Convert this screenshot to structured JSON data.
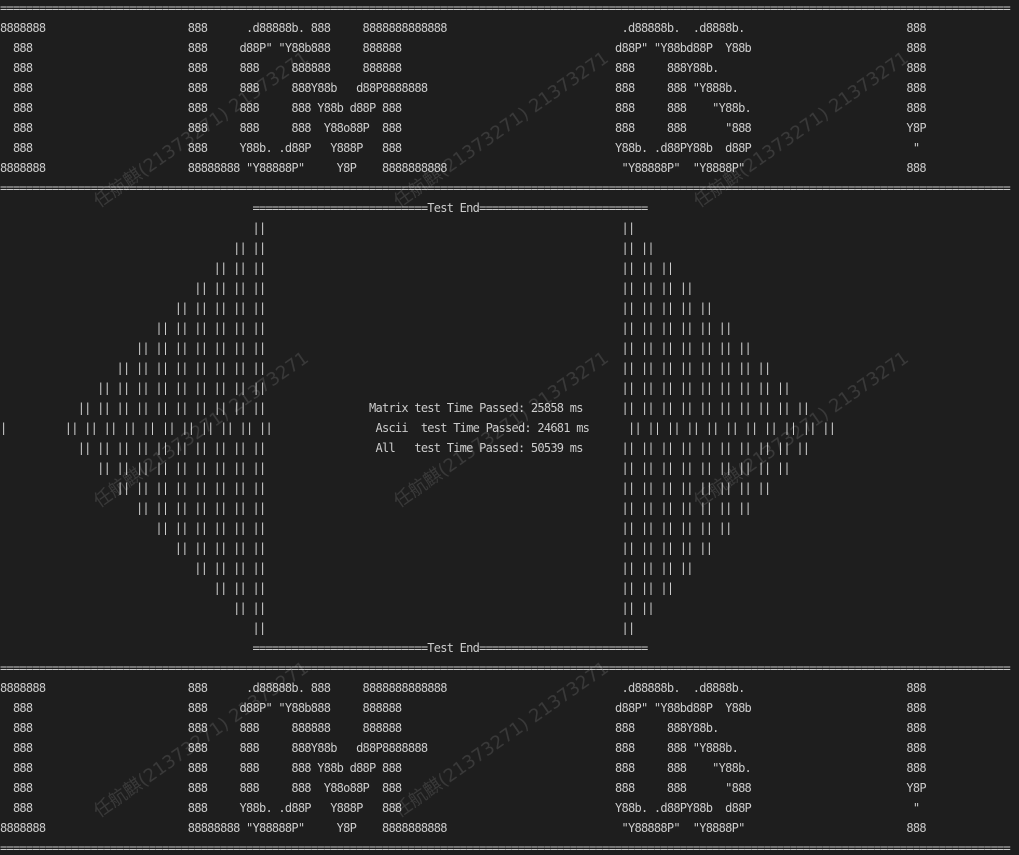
{
  "terminal": {
    "background": "#1e1e1e",
    "foreground": "#cccccc",
    "watermark_text": "任航麒(21373271) 21373271"
  },
  "banner_top": [
    "============================================================================================================================================================",
    "8888888                      888      .d88888b. 888     8888888888888                           .d88888b.  .d8888b.                         888",
    "  888                        888     d88P\" \"Y88b888     888888                                 d88P\" \"Y88bd88P  Y88b                        888",
    "  888                        888     888     888888     888888                                 888     888Y88b.                             888",
    "  888                        888     888     888Y88b   d88P8888888                             888     888 \"Y888b.                          888",
    "  888                        888     888     888 Y88b d88P 888                                 888     888    \"Y88b.                        888",
    "  888                        888     888     888  Y88o88P  888                                 888     888      \"888                        Y8P",
    "  888                        888     Y88b. .d88P   Y888P   888                                 Y88b. .d88PY88b  d88P                         \"",
    "8888888                      88888888 \"Y88888P\"     Y8P    8888888888                           \"Y88888P\"  \"Y8888P\"                         888",
    "============================================================================================================================================================"
  ],
  "test_end_header": "                                       ===========================Test End==========================",
  "diamond_lines": [
    "                                       ||                                                       ||",
    "                                    || ||                                                       || ||",
    "                                 || || ||                                                       || || ||",
    "                              || || || ||                                                       || || || ||",
    "                           || || || || ||                                                       || || || || ||",
    "                        || || || || || ||                                                       || || || || || ||",
    "                     || || || || || || ||                                                       || || || || || || ||",
    "                  || || || || || || || ||                                                       || || || || || || || ||",
    "               || || || || || || || || ||                                                       || || || || || || || || ||",
    "            || || || || || || || || || ||                Matrix test Time Passed: 25858 ms      || || || || || || || || || ||",
    "|         || || || || || || || || || || ||                Ascii  test Time Passed: 24681 ms      || || || || || || || || || || ||",
    "            || || || || || || || || || ||                 All   test Time Passed: 50539 ms      || || || || || || || || || ||",
    "               || || || || || || || || ||                                                       || || || || || || || || ||",
    "                  || || || || || || || ||                                                       || || || || || || || ||",
    "                     || || || || || || ||                                                       || || || || || || ||",
    "                        || || || || || ||                                                       || || || || || ||",
    "                           || || || || ||                                                       || || || || ||",
    "                              || || || ||                                                       || || || ||",
    "                                 || || ||                                                       || || ||",
    "                                    || ||                                                       || ||",
    "                                       ||                                                       ||"
  ],
  "test_end_footer": "                                       ===========================Test End==========================",
  "banner_bottom": [
    "============================================================================================================================================================",
    "8888888                      888      .d88888b. 888     8888888888888                           .d88888b.  .d8888b.                         888",
    "  888                        888     d88P\" \"Y88b888     888888                                 d88P\" \"Y88bd88P  Y88b                        888",
    "  888                        888     888     888888     888888                                 888     888Y88b.                             888",
    "  888                        888     888     888Y88b   d88P8888888                             888     888 \"Y888b.                          888",
    "  888                        888     888     888 Y88b d88P 888                                 888     888    \"Y88b.                        888",
    "  888                        888     888     888  Y88o88P  888                                 888     888      \"888                        Y8P",
    "  888                        888     Y88b. .d88P   Y888P   888                                 Y88b. .d88PY88b  d88P                         \"",
    "8888888                      88888888 \"Y88888P\"     Y8P    8888888888                           \"Y88888P\"  \"Y8888P\"                         888",
    "============================================================================================================================================================"
  ],
  "results": {
    "matrix": "Matrix test Time Passed: 25858 ms",
    "ascii": "Ascii  test Time Passed: 24681 ms",
    "all": "All   test Time Passed: 50539 ms"
  }
}
